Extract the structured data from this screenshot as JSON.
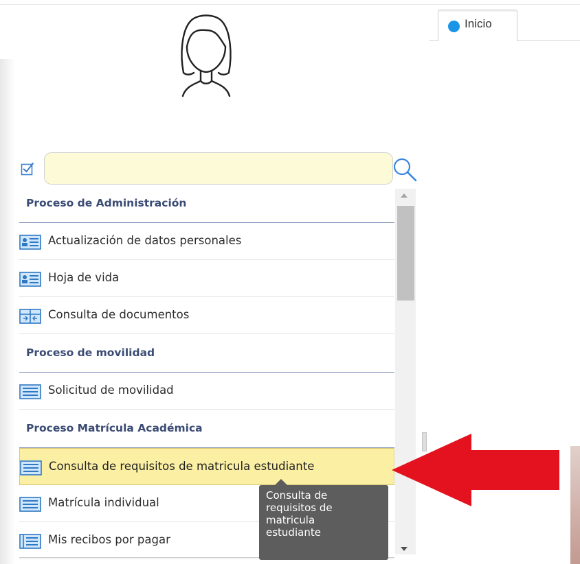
{
  "tabs": [
    {
      "label": "Inicio",
      "color": "#1a95e8"
    }
  ],
  "search": {
    "value": "",
    "placeholder": ""
  },
  "menu": {
    "groups": [
      {
        "title": "Proceso de Administración",
        "items": [
          {
            "label": "Actualización de datos personales",
            "icon": "user-card-icon"
          },
          {
            "label": "Hoja de vida",
            "icon": "user-card-icon"
          },
          {
            "label": "Consulta de documentos",
            "icon": "documents-icon"
          }
        ]
      },
      {
        "title": "Proceso de movilidad",
        "items": [
          {
            "label": "Solicitud de movilidad",
            "icon": "list-icon"
          }
        ]
      },
      {
        "title": "Proceso Matrícula Académica",
        "items": [
          {
            "label": "Consulta de requisitos de matricula estudiante",
            "icon": "list-icon",
            "selected": true
          },
          {
            "label": "Matrícula individual",
            "icon": "list-icon"
          },
          {
            "label": "Mis recibos por pagar",
            "icon": "receipt-icon"
          }
        ]
      }
    ]
  },
  "tooltip": {
    "text": [
      "Consulta de",
      "requisitos de",
      "matricula",
      "estudiante"
    ]
  },
  "colors": {
    "accent": "#1a95e8",
    "header_text": "#3b4c74",
    "selected_bg": "#fbefa4",
    "search_bg": "#fdfbd7",
    "annotation_arrow": "#e4121e"
  }
}
